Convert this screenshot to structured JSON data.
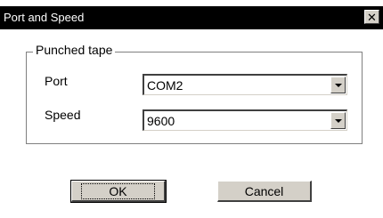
{
  "window": {
    "title": "Port and Speed",
    "close_glyph": "✕"
  },
  "group": {
    "label": "Punched tape"
  },
  "port": {
    "label": "Port",
    "value": "COM2"
  },
  "speed": {
    "label": "Speed",
    "value": "9600"
  },
  "buttons": {
    "ok_label": "OK",
    "cancel_label": "Cancel"
  },
  "colors": {
    "title_bar": "#000000",
    "face": "#d4d0c8",
    "background": "#ffffff"
  }
}
